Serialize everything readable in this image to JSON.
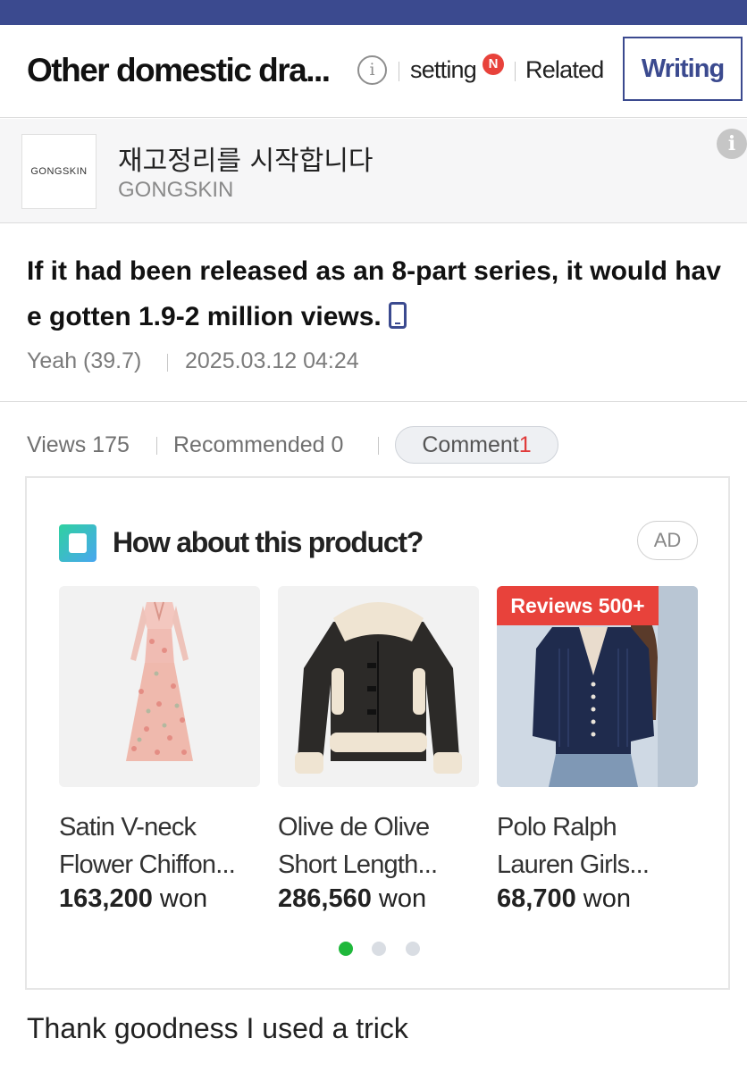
{
  "header": {
    "title": "Other domestic dra...",
    "info_icon": "info-icon",
    "setting_label": "setting",
    "setting_badge": "N",
    "related_label": "Related",
    "write_label": "Writing",
    "accent_color": "#3b4a8f"
  },
  "ad_banner": {
    "logo_text": "GONGSKIN",
    "title": "재고정리를 시작합니다",
    "advertiser": "GONGSKIN",
    "info_icon": "info-icon"
  },
  "post": {
    "title": "If it had been released as an 8-part series, it would have gotten 1.9-2 million views.",
    "device_icon": "mobile-phone-icon",
    "author": "Yeah (39.7)",
    "date": "2025.03.12 04:24",
    "body": "Thank goodness I used a trick"
  },
  "stats": {
    "views": "Views 175",
    "recommended": "Recommended 0",
    "comment_label": "Comment",
    "comment_count": "1"
  },
  "product_widget": {
    "title": "How about this product?",
    "ad_label": "AD",
    "page_count": 3,
    "active_page": 1,
    "products": [
      {
        "name_line1": "Satin V-neck",
        "name_line2": "Flower Chiffon...",
        "price": "163,200",
        "currency": "won",
        "image": "floral-dress-image",
        "badge": ""
      },
      {
        "name_line1": "Olive de Olive",
        "name_line2": "Short Length...",
        "price": "286,560",
        "currency": "won",
        "image": "shearling-jacket-image",
        "badge": ""
      },
      {
        "name_line1": "Polo Ralph",
        "name_line2": "Lauren Girls...",
        "price": "68,700",
        "currency": "won",
        "image": "navy-cardigan-image",
        "badge": "Reviews 500+"
      }
    ]
  }
}
